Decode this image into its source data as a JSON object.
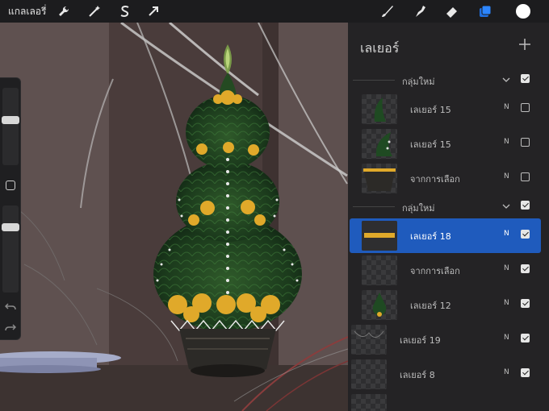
{
  "toolbar": {
    "gallery_label": "แกลเลอรี่",
    "left_icons": [
      "wrench-icon",
      "magic-wand-icon",
      "selection-s-icon",
      "transform-arrow-icon"
    ],
    "right_icons": [
      "brush-icon",
      "smudge-icon",
      "eraser-icon",
      "layers-icon",
      "color-swatch-icon"
    ],
    "accent_color": "#1f6fe0",
    "current_color": "#ffffff"
  },
  "sidebar": {
    "icons": [
      "modify-square-icon",
      "undo-icon",
      "redo-icon"
    ]
  },
  "layers_panel": {
    "title": "เลเยอร์",
    "rows": [
      {
        "kind": "group",
        "name": "กลุ่มใหม่",
        "mode": "",
        "visible": true
      },
      {
        "kind": "layer",
        "name": "เลเยอร์ 15",
        "mode": "N",
        "visible": false
      },
      {
        "kind": "layer",
        "name": "เลเยอร์ 15",
        "mode": "N",
        "visible": false
      },
      {
        "kind": "layer",
        "name": "จากการเลือก",
        "mode": "N",
        "visible": false
      },
      {
        "kind": "group",
        "name": "กลุ่มใหม่",
        "mode": "",
        "visible": true
      },
      {
        "kind": "layer",
        "name": "เลเยอร์ 18",
        "mode": "N",
        "visible": true,
        "selected": true
      },
      {
        "kind": "layer",
        "name": "จากการเลือก",
        "mode": "N",
        "visible": true
      },
      {
        "kind": "layer",
        "name": "เลเยอร์ 12",
        "mode": "N",
        "visible": true
      },
      {
        "kind": "layer",
        "name": "เลเยอร์ 19",
        "mode": "N",
        "visible": true
      },
      {
        "kind": "layer",
        "name": "เลเยอร์ 8",
        "mode": "N",
        "visible": true
      }
    ]
  }
}
